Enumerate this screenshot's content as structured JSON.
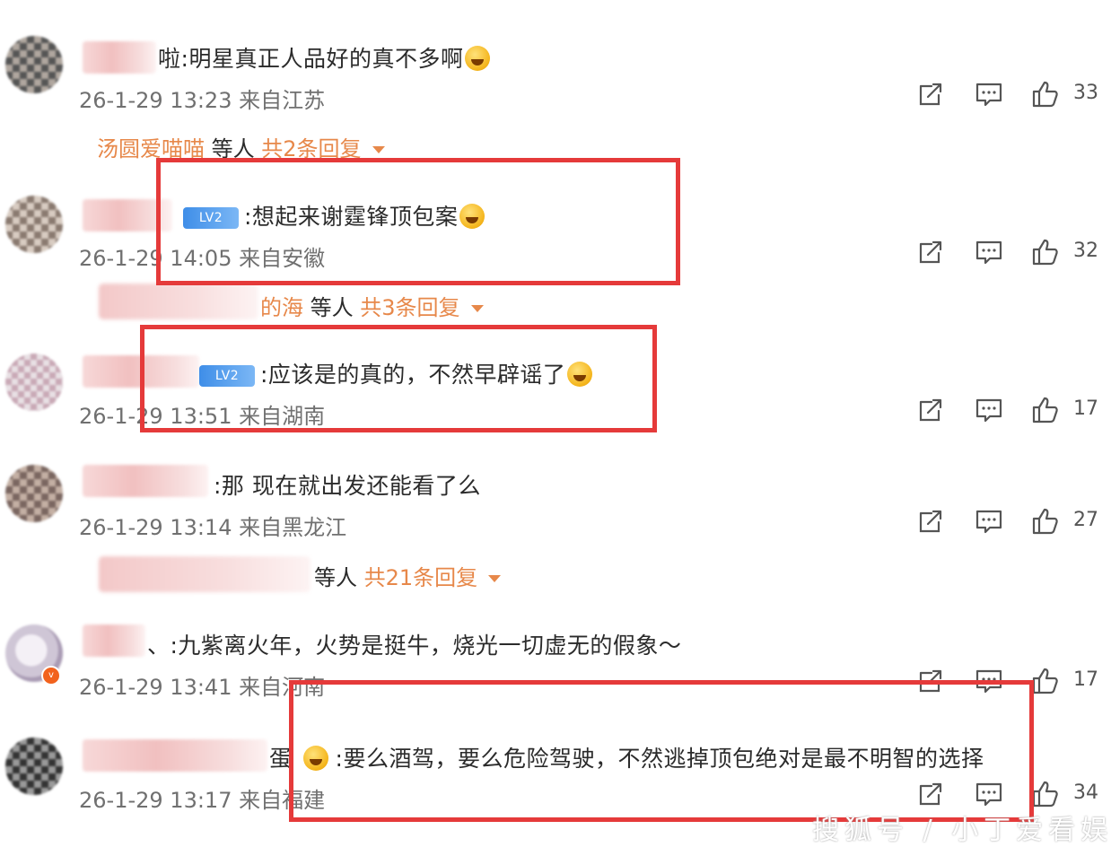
{
  "comments": [
    {
      "avatar_style": "a1",
      "text": ":明星真正人品好的真不多啊",
      "name_tail": "啦",
      "emoji": "grin-sweat-emoji",
      "meta": "26-1-29 13:23 来自江苏",
      "likes": "33"
    },
    {
      "avatar_style": "a2",
      "badge": "LV2",
      "text": ":想起来谢霆锋顶包案",
      "emoji": "grin-sweat-emoji",
      "meta": "26-1-29 14:05 来自安徽",
      "likes": "32"
    },
    {
      "avatar_style": "a3",
      "badge": "LV2",
      "text": ":应该是的真的，不然早辟谣了",
      "emoji": "cat-smirk-emoji",
      "meta": "26-1-29 13:51 来自湖南",
      "likes": "17"
    },
    {
      "avatar_style": "a4",
      "text": ":那 现在就出发还能看了么",
      "meta": "26-1-29 13:14 来自黑龙江",
      "likes": "27"
    },
    {
      "avatar_style": "a5",
      "text": "、:九紫离火年，火势是挺牛，烧光一切虚无的假象～",
      "meta": "26-1-29 13:41 来自河南",
      "likes": "17"
    },
    {
      "avatar_style": "a6",
      "name_tail": "蛋",
      "text": ":要么酒驾，要么危险驾驶，不然逃掉顶包绝对是最不明智的选择",
      "meta": "26-1-29 13:17 来自福建",
      "likes": "34"
    }
  ],
  "replies": [
    {
      "who": "汤圆爱喵喵",
      "sep": " 等人 ",
      "count": "共2条回复"
    },
    {
      "who": "的海",
      "sep": " 等人 ",
      "count": "共3条回复"
    },
    {
      "who": "",
      "sep": "等人 ",
      "count": "共21条回复"
    }
  ],
  "watermark": "搜狐号 / 小丁爱看娱乐",
  "colors": {
    "highlight_box": "#e53a3a",
    "reply_link": "#e7884a",
    "meta_text": "#707070"
  },
  "icons": [
    "share-icon",
    "comment-icon",
    "like-icon"
  ]
}
